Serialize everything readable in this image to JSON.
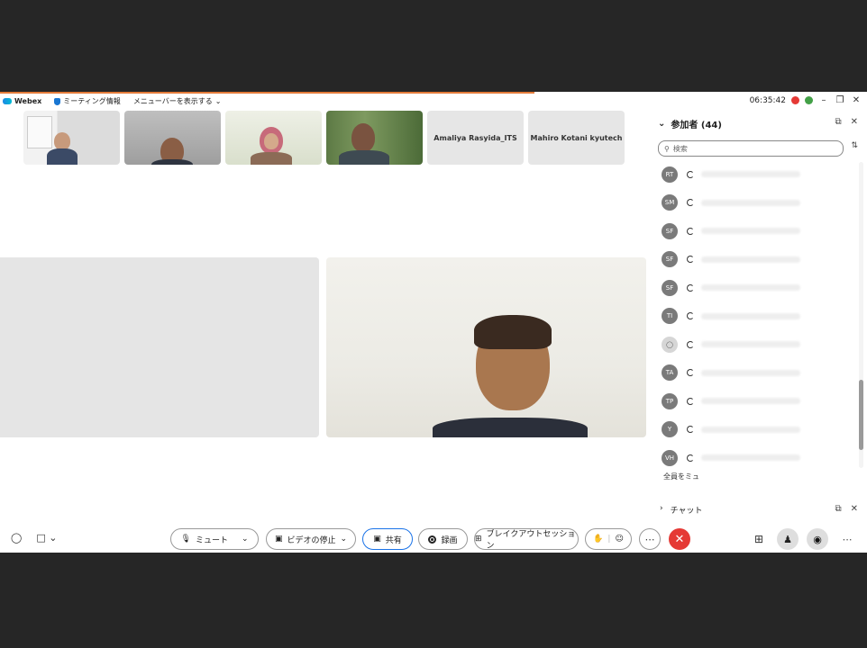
{
  "titlebar": {
    "app_name": "Webex",
    "meeting_info": "ミーティング情報",
    "show_menu": "メニューバーを表示する",
    "time": "06:35:42"
  },
  "thumbnails": [
    {
      "type": "video",
      "kind": "office"
    },
    {
      "type": "video",
      "kind": "room"
    },
    {
      "type": "video",
      "kind": "hijab"
    },
    {
      "type": "video",
      "kind": "forest"
    },
    {
      "type": "name",
      "label": "Amaliya Rasyida_ITS"
    },
    {
      "type": "name",
      "label": "Mahiro Kotani kyutech"
    }
  ],
  "participants": {
    "title": "参加者 (44)",
    "search_placeholder": "検索",
    "rows": [
      {
        "initials": "RT"
      },
      {
        "initials": "SM"
      },
      {
        "initials": "SF"
      },
      {
        "initials": "SF"
      },
      {
        "initials": "SF"
      },
      {
        "initials": "TI"
      },
      {
        "initials": ""
      },
      {
        "initials": "TA"
      },
      {
        "initials": "TP"
      },
      {
        "initials": "Y"
      },
      {
        "initials": "VH"
      }
    ],
    "mute_all": "全員をミュ"
  },
  "chat": {
    "label": "チャット"
  },
  "toolbar": {
    "mute": "ミュート",
    "stop_video": "ビデオの停止",
    "share": "共有",
    "record": "録画",
    "breakout": "ブレイクアウトセッション"
  },
  "colors": {
    "end_call": "#e53935",
    "accent": "#1a73e8",
    "titlebar_line": "#e37b3a"
  }
}
